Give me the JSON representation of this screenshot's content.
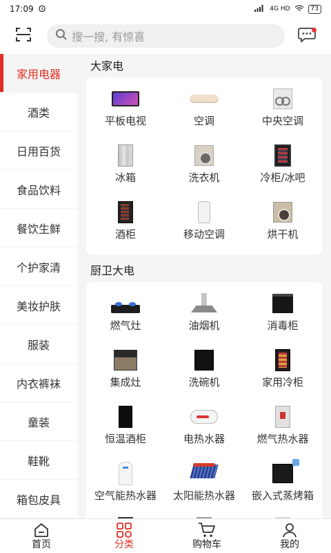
{
  "status_bar": {
    "time": "17:09",
    "network": "4G HD",
    "battery": "73"
  },
  "header": {
    "search_placeholder": "搜一搜, 有惊喜"
  },
  "sidebar": {
    "items": [
      {
        "label": "家用电器"
      },
      {
        "label": "酒类"
      },
      {
        "label": "日用百货"
      },
      {
        "label": "食品饮料"
      },
      {
        "label": "餐饮生鲜"
      },
      {
        "label": "个护家清"
      },
      {
        "label": "美妆护肤"
      },
      {
        "label": "服装"
      },
      {
        "label": "内衣裤袜"
      },
      {
        "label": "童装"
      },
      {
        "label": "鞋靴"
      },
      {
        "label": "箱包皮具"
      }
    ]
  },
  "sections": [
    {
      "title": "大家电",
      "items": [
        {
          "label": "平板电视",
          "icon": "tv-icon"
        },
        {
          "label": "空调",
          "icon": "air-conditioner-icon"
        },
        {
          "label": "中央空调",
          "icon": "central-ac-icon"
        },
        {
          "label": "冰箱",
          "icon": "refrigerator-icon"
        },
        {
          "label": "洗衣机",
          "icon": "washing-machine-icon"
        },
        {
          "label": "冷柜/冰吧",
          "icon": "freezer-icon"
        },
        {
          "label": "酒柜",
          "icon": "wine-cabinet-icon"
        },
        {
          "label": "移动空调",
          "icon": "portable-ac-icon"
        },
        {
          "label": "烘干机",
          "icon": "dryer-icon"
        }
      ]
    },
    {
      "title": "厨卫大电",
      "items": [
        {
          "label": "燃气灶",
          "icon": "gas-stove-icon"
        },
        {
          "label": "油烟机",
          "icon": "range-hood-icon"
        },
        {
          "label": "消毒柜",
          "icon": "sterilizer-icon"
        },
        {
          "label": "集成灶",
          "icon": "integrated-stove-icon"
        },
        {
          "label": "洗碗机",
          "icon": "dishwasher-icon"
        },
        {
          "label": "家用冷柜",
          "icon": "home-freezer-icon"
        },
        {
          "label": "恒温酒柜",
          "icon": "thermostatic-wine-cabinet-icon"
        },
        {
          "label": "电热水器",
          "icon": "electric-water-heater-icon"
        },
        {
          "label": "燃气热水器",
          "icon": "gas-water-heater-icon"
        },
        {
          "label": "空气能热水器",
          "icon": "heat-pump-water-heater-icon"
        },
        {
          "label": "太阳能热水器",
          "icon": "solar-water-heater-icon"
        },
        {
          "label": "嵌入式蒸烤箱",
          "icon": "built-in-steam-oven-icon"
        }
      ]
    }
  ],
  "bottom_nav": {
    "items": [
      {
        "label": "首页",
        "icon": "home-icon"
      },
      {
        "label": "分类",
        "icon": "category-grid-icon"
      },
      {
        "label": "购物车",
        "icon": "cart-icon"
      },
      {
        "label": "我的",
        "icon": "user-icon"
      }
    ],
    "active": "分类"
  },
  "colors": {
    "accent": "#e02e24",
    "background": "#f5f5f5",
    "card": "#ffffff"
  }
}
